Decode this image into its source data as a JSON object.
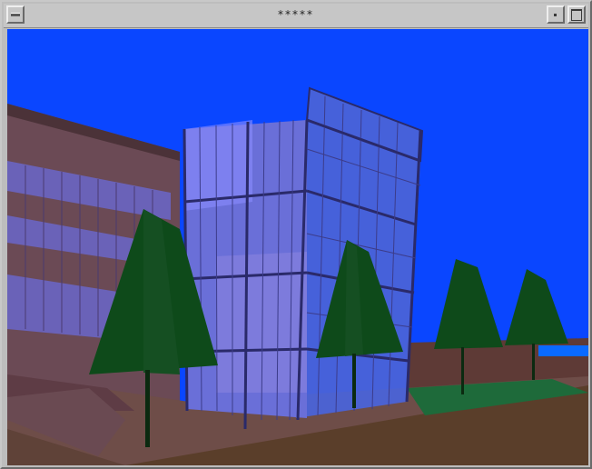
{
  "window": {
    "title": "*****"
  },
  "icons": {
    "menu": "window-menu-icon",
    "minimize": "minimize-icon",
    "maximize": "maximize-icon"
  },
  "scene": {
    "colors": {
      "sky": "#0a46ff",
      "ground": "#5a3e2a",
      "glass": "#6a6fd8",
      "building": "#6b4e58",
      "tree": "#0e4a1a"
    }
  }
}
